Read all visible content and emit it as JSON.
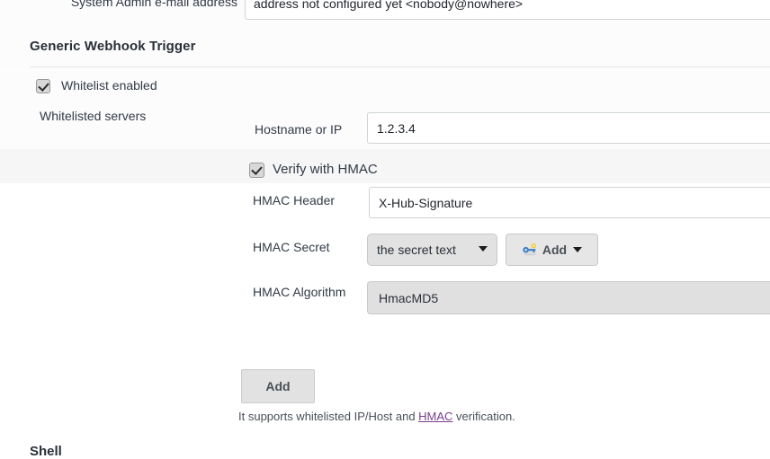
{
  "system_admin": {
    "label": "System Admin e-mail address",
    "value": "address not configured yet <nobody@nowhere>"
  },
  "section": {
    "title": "Generic Webhook Trigger"
  },
  "whitelist": {
    "enabled_label": "Whitelist enabled",
    "enabled_checked": true,
    "servers_label": "Whitelisted servers"
  },
  "hostname": {
    "label": "Hostname or IP",
    "value": "1.2.3.4"
  },
  "verify_hmac": {
    "label": "Verify with HMAC",
    "checked": true
  },
  "hmac_header": {
    "label": "HMAC Header",
    "value": "X-Hub-Signature"
  },
  "hmac_secret": {
    "label": "HMAC Secret",
    "selected": "the secret text",
    "add_button_label": "Add",
    "add_button_icon": "key-icon",
    "dropdown_icon": "chevron-down-icon"
  },
  "hmac_algorithm": {
    "label": "HMAC Algorithm",
    "selected": "HmacMD5"
  },
  "actions": {
    "add_label": "Add",
    "help_prefix": "It supports whitelisted IP/Host and ",
    "help_link": "HMAC",
    "help_suffix": " verification."
  },
  "next_section": {
    "title": "Shell"
  },
  "colors": {
    "link": "#7a3b8c",
    "text": "#333a45",
    "heading": "#2a2f38",
    "control_gray": "#e2e2e2",
    "field_border": "#cfd2d6"
  }
}
